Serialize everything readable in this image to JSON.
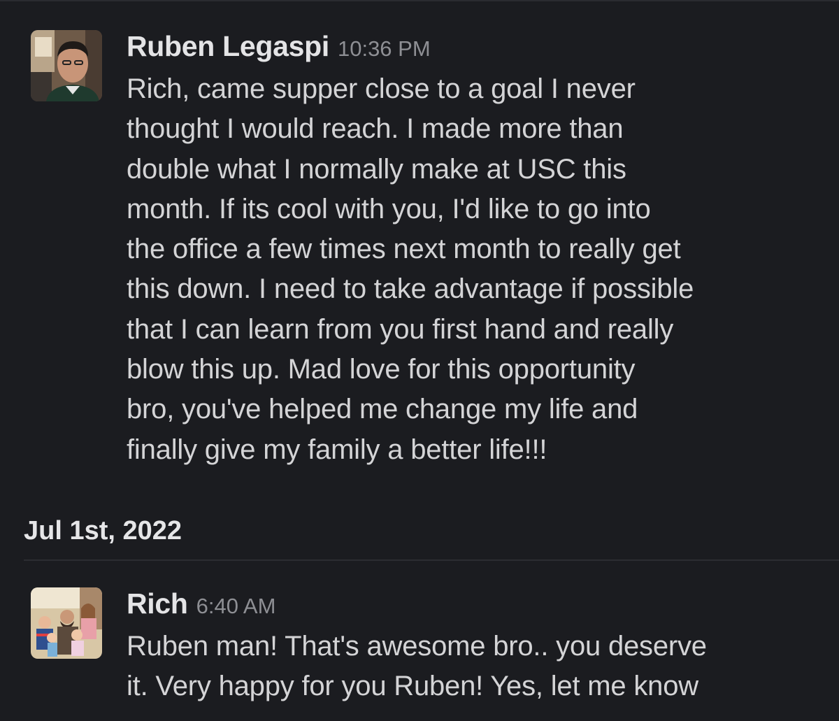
{
  "messages": [
    {
      "author": "Ruben Legaspi",
      "time": "10:36 PM",
      "avatar_icon": "user-avatar-photo",
      "lines": [
        "Rich, came supper close to a goal I never",
        "thought I would reach. I made more than",
        "double what I normally make at USC this",
        "month. If its cool with you, I'd like to go into",
        "the office a few times next month to really get",
        "this down. I need to take advantage if possible",
        "that I can learn from you first hand and really",
        "blow this up. Mad love for this opportunity",
        "bro, you've helped me change my life  and",
        "finally give my family a better life!!!"
      ]
    },
    {
      "author": "Rich",
      "time": "6:40 AM",
      "avatar_icon": "family-avatar-photo",
      "lines": [
        "Ruben man! That's awesome bro.. you deserve",
        "it. Very happy for you Ruben! Yes, let me know"
      ]
    }
  ],
  "date_divider": {
    "label": "Jul 1st, 2022"
  },
  "colors": {
    "background": "#1b1c20",
    "text": "#d4d4d6",
    "timestamp": "#8e8f94",
    "divider": "#2c2d32"
  }
}
